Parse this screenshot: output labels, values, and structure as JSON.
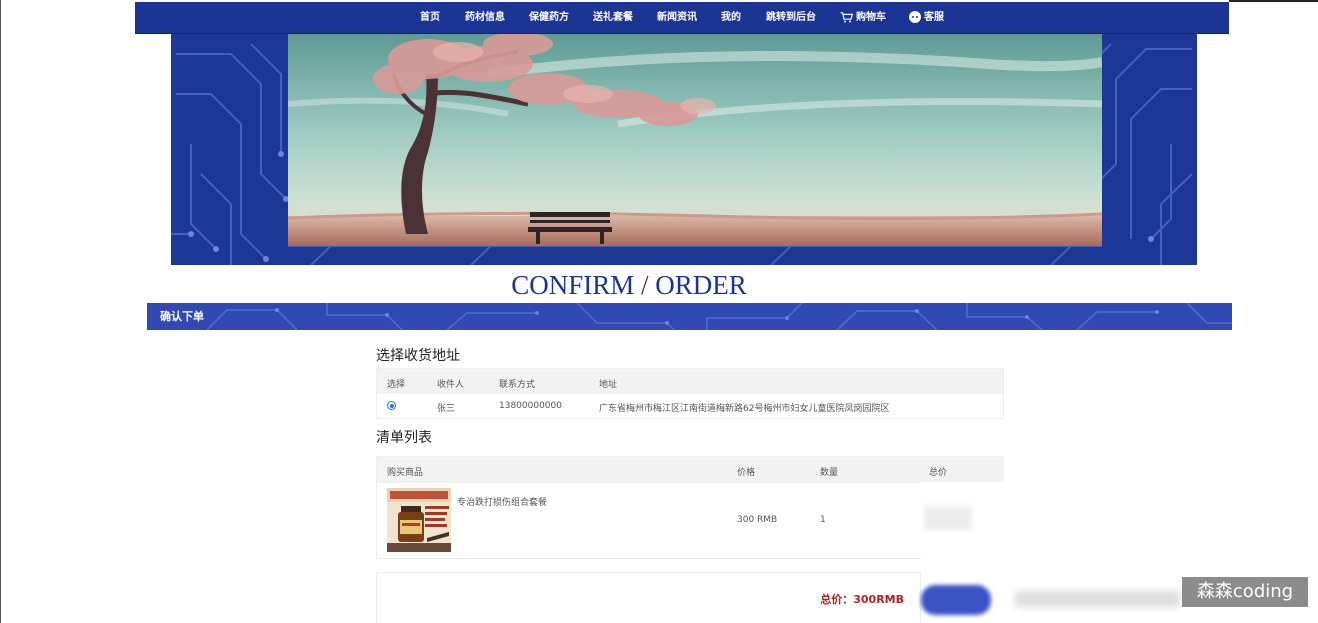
{
  "nav": {
    "items": [
      "首页",
      "药材信息",
      "保健药方",
      "送礼套餐",
      "新闻资讯",
      "我的",
      "跳转到后台"
    ],
    "cart_label": "购物车",
    "service_label": "客服"
  },
  "page_title": "CONFIRM / ORDER",
  "section_bar_label": "确认下单",
  "address_section": {
    "title": "选择收货地址",
    "headers": [
      "选择",
      "收件人",
      "联系方式",
      "地址"
    ],
    "rows": [
      {
        "selected": true,
        "name": "张三",
        "phone": "13800000000",
        "address": "广东省梅州市梅江区江南街道梅新路62号梅州市妇女儿童医院凤岗园院区"
      }
    ]
  },
  "list_section": {
    "title": "清单列表",
    "headers": [
      "购买商品",
      "价格",
      "数量",
      "总价"
    ],
    "rows": [
      {
        "product_name": "专治跌打损伤组合套餐",
        "price": "300 RMB",
        "quantity": "1"
      }
    ]
  },
  "total_label": "总价：300RMB",
  "watermark": "森森coding",
  "colors": {
    "nav": "#1c3594",
    "accent": "#3349b2",
    "total": "#b41f1f"
  }
}
